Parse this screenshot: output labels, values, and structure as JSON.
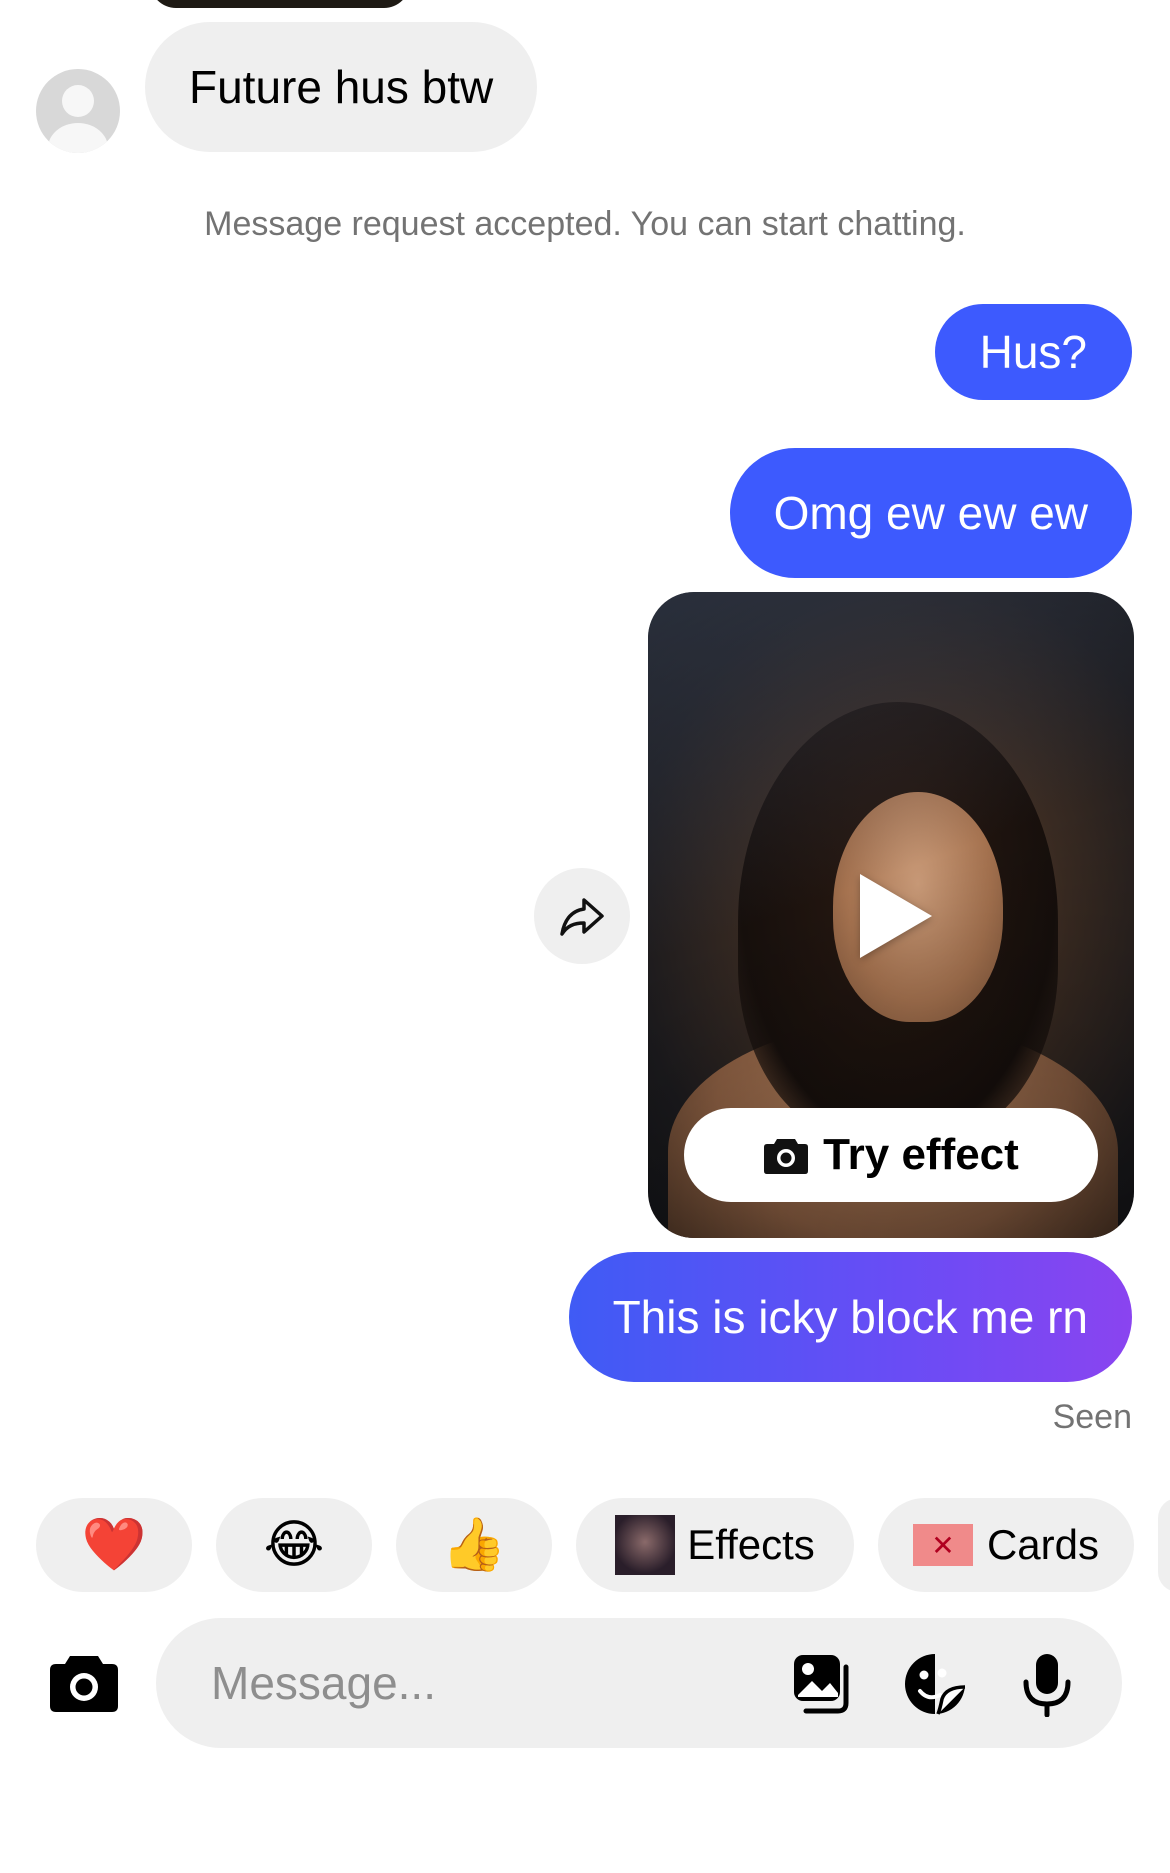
{
  "thread": {
    "incoming_message": "Future hus btw",
    "system_notice": "Message request accepted. You can start chatting.",
    "outgoing": [
      {
        "text": "Hus?"
      },
      {
        "text": "Omg ew ew ew"
      }
    ],
    "media_message": {
      "action_label": "Try effect",
      "icon": "play-icon"
    },
    "last_outgoing": "This is icky block me rn",
    "status": "Seen"
  },
  "quick_reactions": [
    {
      "emoji": "❤️",
      "icon": "red-heart-emoji"
    },
    {
      "emoji": "😂",
      "icon": "tears-of-joy-emoji"
    },
    {
      "emoji": "👍",
      "icon": "thumbs-up-emoji"
    }
  ],
  "quick_actions": {
    "effects_label": "Effects",
    "cards_label": "Cards"
  },
  "composer": {
    "placeholder": "Message..."
  },
  "colors": {
    "outgoing_bubble": "#3d5afe",
    "incoming_bubble": "#efefef",
    "muted_text": "#737373"
  }
}
